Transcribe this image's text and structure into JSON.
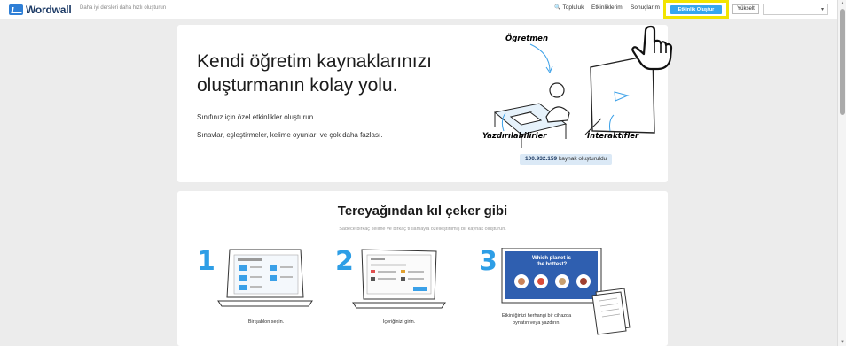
{
  "header": {
    "logo_text": "Wordwall",
    "tagline": "Daha iyi dersleri daha hızlı oluşturun",
    "nav": [
      {
        "label": "Topluluk",
        "icon": "search-icon"
      },
      {
        "label": "Etkinliklerim"
      },
      {
        "label": "Sonuçlarım"
      }
    ],
    "cta_label": "Etkinlik Oluştur",
    "upgrade_label": "Yükselt",
    "highlight_color": "#f2e400",
    "accent_color": "#35a6ef"
  },
  "hero": {
    "title": "Kendi öğretim kaynaklarınızı oluşturmanın kolay yolu.",
    "sub1": "Sınıfınız için özel etkinlikler oluşturun.",
    "sub2": "Sınavlar, eşleştirmeler, kelime oyunları ve çok daha fazlası.",
    "label_teacher": "Öğretmen",
    "label_printable": "Yazdırılabilirler",
    "label_interactive": "İnteraktifler",
    "counter_value": "100.932.159",
    "counter_text": "kaynak oluşturuldu"
  },
  "steps_section": {
    "title": "Tereyağından kıl çeker gibi",
    "subtitle": "Sadece birkaç kelime ve birkaç tıklamayla özelleştirilmiş bir kaynak oluşturun.",
    "steps": [
      {
        "number": "1",
        "caption": "Bir şablon seçin."
      },
      {
        "number": "2",
        "caption": "İçeriğinizi girin."
      },
      {
        "number": "3",
        "caption": "Etkinliğinizi herhangi bir cihazda oynatın veya yazdırın.",
        "screen_text": "Which planet is the hottest?"
      }
    ]
  }
}
